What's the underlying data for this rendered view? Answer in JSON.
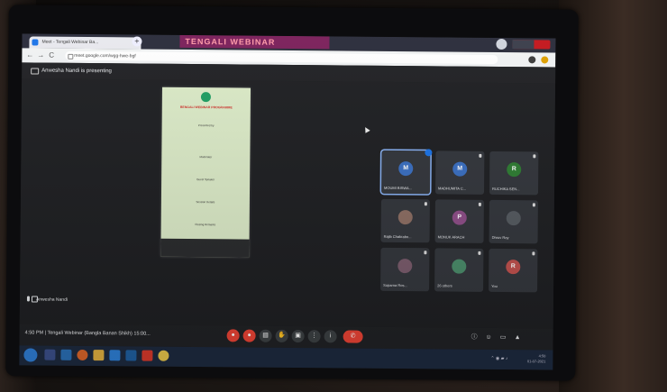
{
  "browser": {
    "tab_title": "Meet - Tengali Webinar Ba...",
    "tab_close": "×",
    "new_tab": "+",
    "banner": "TENGALI WEBINAR",
    "url": "meet.google.com/wgg-hwe-bgf",
    "nav_back": "←",
    "nav_forward": "→",
    "nav_reload": "C"
  },
  "presenting": {
    "text": "Anwesha Nandi is presenting"
  },
  "slide": {
    "lines": [
      "BENGALI WEBINAR PROGRAMME",
      "Presented by",
      "Moderator",
      "Guest Speaker",
      "Session Details",
      "Closing Remarks"
    ]
  },
  "presenter_label": "Anwesha Nandi",
  "participants": [
    {
      "initial": "M",
      "name": "MOUMI BISWA...",
      "color": "#3a6fc2",
      "active": true
    },
    {
      "initial": "M",
      "name": "MADHUMITA C...",
      "color": "#3a6fc2",
      "active": false
    },
    {
      "initial": "R",
      "name": "RUCHIKA SEN...",
      "color": "#2e7d32",
      "active": false
    },
    {
      "initial": "",
      "name": "Rajib Chakrabo...",
      "color": "#8d6e63",
      "active": false
    },
    {
      "initial": "P",
      "name": "MONUK ARACH",
      "color": "#8e4d88",
      "active": false
    },
    {
      "initial": "",
      "name": "Dhruv Roy",
      "color": "#555a60",
      "active": false
    },
    {
      "initial": "",
      "name": "Suparna Ros...",
      "color": "#7a5b6c",
      "active": false
    },
    {
      "initial": "",
      "name": "26 others",
      "color": "#4a8c6a",
      "active": false
    },
    {
      "initial": "R",
      "name": "You",
      "color": "#c0504d",
      "active": false
    }
  ],
  "toolbar": {
    "meeting_info": "4:50 PM  |  Tengali Webinar (Bangla Banan Shikh) 15:00...",
    "end_call": "✆"
  },
  "taskbar": {
    "time": "4:50",
    "date": "01-07-2021"
  },
  "colors": {
    "accent": "#8ab4f8",
    "end_call": "#ea4335",
    "meet_bg": "#202124"
  }
}
